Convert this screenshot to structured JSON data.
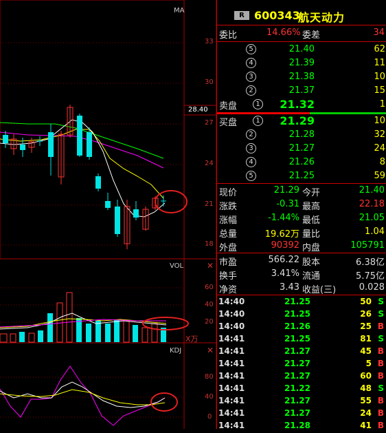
{
  "kline": {
    "indicator": "MA",
    "y_ticks": [
      "33",
      "30",
      "27",
      "24",
      "21",
      "18"
    ],
    "current_price_tag": "28.40"
  },
  "vol": {
    "label": "VOL",
    "y_ticks": [
      "60",
      "40",
      "20"
    ],
    "unit": "X万"
  },
  "kdj": {
    "label": "KDJ",
    "y_ticks": [
      "80",
      "40",
      "0"
    ]
  },
  "quote": {
    "badge": "R",
    "code": "600343",
    "name": "航天动力",
    "weibi_label": "委比",
    "weibi_value": "14.66%",
    "weicha_label": "委差",
    "weicha_value": "34",
    "sell_label": "卖盘",
    "buy_label": "买盘",
    "sell": [
      {
        "lvl": "5",
        "price": "21.40",
        "vol": "62"
      },
      {
        "lvl": "4",
        "price": "21.39",
        "vol": "11"
      },
      {
        "lvl": "3",
        "price": "21.38",
        "vol": "10"
      },
      {
        "lvl": "2",
        "price": "21.37",
        "vol": "15"
      },
      {
        "lvl": "1",
        "price": "21.32",
        "vol": "1"
      }
    ],
    "buy": [
      {
        "lvl": "1",
        "price": "21.29",
        "vol": "10"
      },
      {
        "lvl": "2",
        "price": "21.28",
        "vol": "32"
      },
      {
        "lvl": "3",
        "price": "21.27",
        "vol": "24"
      },
      {
        "lvl": "4",
        "price": "21.26",
        "vol": "8"
      },
      {
        "lvl": "5",
        "price": "21.25",
        "vol": "59"
      }
    ],
    "stats": [
      {
        "l1": "现价",
        "v1": "21.29",
        "c1": "green",
        "l2": "今开",
        "v2": "21.40",
        "c2": "green"
      },
      {
        "l1": "涨跌",
        "v1": "-0.31",
        "c1": "green",
        "l2": "最高",
        "v2": "22.18",
        "c2": "red"
      },
      {
        "l1": "涨幅",
        "v1": "-1.44%",
        "c1": "green",
        "l2": "最低",
        "v2": "21.05",
        "c2": "green"
      },
      {
        "l1": "总量",
        "v1": "19.62万",
        "c1": "yellow",
        "l2": "量比",
        "v2": "1.04",
        "c2": "yellow"
      },
      {
        "l1": "外盘",
        "v1": "90392",
        "c1": "red",
        "l2": "内盘",
        "v2": "105791",
        "c2": "green"
      }
    ],
    "stats2": [
      {
        "l1": "市盈",
        "v1": "566.22",
        "l2": "股本",
        "v2": "6.38亿"
      },
      {
        "l1": "换手",
        "v1": "3.41%",
        "l2": "流通",
        "v2": "5.75亿"
      },
      {
        "l1": "净资",
        "v1": "3.43",
        "l2": "收益(三)",
        "v2": "0.028"
      }
    ],
    "ticks": [
      {
        "t": "14:40",
        "p": "21.25",
        "v": "50",
        "d": "S"
      },
      {
        "t": "14:40",
        "p": "21.25",
        "v": "26",
        "d": "S"
      },
      {
        "t": "14:40",
        "p": "21.26",
        "v": "25",
        "d": "B"
      },
      {
        "t": "14:41",
        "p": "21.25",
        "v": "81",
        "d": "S"
      },
      {
        "t": "14:41",
        "p": "21.27",
        "v": "45",
        "d": "B"
      },
      {
        "t": "14:41",
        "p": "21.27",
        "v": "5",
        "d": "B"
      },
      {
        "t": "14:41",
        "p": "21.27",
        "v": "60",
        "d": "B"
      },
      {
        "t": "14:41",
        "p": "21.22",
        "v": "48",
        "d": "S"
      },
      {
        "t": "14:41",
        "p": "21.27",
        "v": "55",
        "d": "B"
      },
      {
        "t": "14:41",
        "p": "21.27",
        "v": "24",
        "d": "B"
      },
      {
        "t": "14:41",
        "p": "21.28",
        "v": "41",
        "d": "B"
      }
    ]
  },
  "colors": {
    "up": "#ff3333",
    "down": "#00e5e5",
    "ma_white": "#ffffff",
    "ma_yellow": "#ffff00",
    "ma_magenta": "#ff00ff",
    "ma_green": "#00ff00",
    "grid": "#800000"
  }
}
